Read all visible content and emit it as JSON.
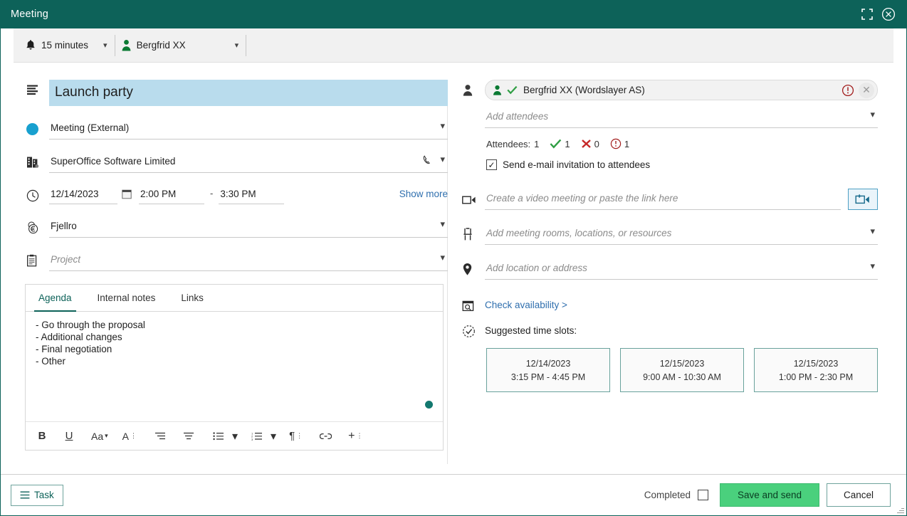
{
  "window": {
    "title": "Meeting",
    "maximize_icon": "fullscreen-icon",
    "close_icon": "close-circle-icon"
  },
  "toolbar": {
    "reminder": {
      "icon": "bell-icon",
      "value": "15 minutes"
    },
    "owner": {
      "icon": "person-icon",
      "value": "Bergfrid XX"
    }
  },
  "left": {
    "title_field": {
      "value": "Launch party",
      "icon": "description-icon"
    },
    "category": {
      "value": "Meeting (External)",
      "icon": "category-dot-icon",
      "color": "#18a0cf"
    },
    "company": {
      "value": "SuperOffice Software Limited",
      "icon": "building-icon",
      "phone_icon": "phone-icon"
    },
    "date": {
      "icon": "clock-icon",
      "date_value": "12/14/2023",
      "calendar_icon": "calendar-icon",
      "start_time": "2:00 PM",
      "separator": "-",
      "end_time": "3:30 PM",
      "show_more": "Show more"
    },
    "sale": {
      "value": "Fjellro",
      "icon": "sale-euro-icon"
    },
    "project": {
      "placeholder": "Project",
      "icon": "clipboard-icon"
    },
    "editor": {
      "tabs": [
        {
          "label": "Agenda",
          "active": true
        },
        {
          "label": "Internal notes",
          "active": false
        },
        {
          "label": "Links",
          "active": false
        }
      ],
      "content_lines": [
        "- Go through the proposal",
        "- Additional changes",
        "- Final negotiation",
        "- Other"
      ],
      "toolbar_buttons": [
        {
          "name": "bold-button",
          "label": "B"
        },
        {
          "name": "underline-button",
          "label": "U"
        },
        {
          "name": "font-size-button",
          "label": "Aa"
        },
        {
          "name": "text-color-button",
          "label": "A"
        },
        {
          "name": "align-right-button",
          "label": ""
        },
        {
          "name": "align-center-button",
          "label": ""
        },
        {
          "name": "bullet-list-button",
          "label": ""
        },
        {
          "name": "numbered-list-button",
          "label": ""
        },
        {
          "name": "paragraph-button",
          "label": "¶"
        },
        {
          "name": "insert-link-button",
          "label": ""
        },
        {
          "name": "insert-more-button",
          "label": "+"
        }
      ]
    }
  },
  "right": {
    "attendee_chip": {
      "icon": "person-icon",
      "status_icon": "check-icon",
      "name": "Bergfrid XX (Wordslayer AS)",
      "warning_icon": "warning-circle-icon",
      "remove_icon": "close-icon"
    },
    "add_attendees": {
      "placeholder": "Add attendees"
    },
    "attendee_stats": {
      "label": "Attendees:",
      "total": "1",
      "accepted": "1",
      "declined": "0",
      "pending": "1"
    },
    "send_invitation": {
      "label": "Send e-mail invitation to attendees",
      "checked": true
    },
    "video": {
      "icon": "video-camera-icon",
      "placeholder": "Create a video meeting or paste the link here",
      "button_icon": "add-video-icon"
    },
    "rooms": {
      "icon": "chair-icon",
      "placeholder": "Add meeting rooms, locations, or resources"
    },
    "location": {
      "icon": "location-pin-icon",
      "placeholder": "Add location or address"
    },
    "check_availability": {
      "icon": "calendar-search-icon",
      "label": "Check availability >"
    },
    "suggested": {
      "icon": "clock-check-icon",
      "label": "Suggested time slots:",
      "slots": [
        {
          "date": "12/14/2023",
          "time": "3:15 PM - 4:45 PM"
        },
        {
          "date": "12/15/2023",
          "time": "9:00 AM - 10:30 AM"
        },
        {
          "date": "12/15/2023",
          "time": "1:00 PM - 2:30 PM"
        }
      ]
    }
  },
  "footer": {
    "task_button": "Task",
    "completed_label": "Completed",
    "completed_checked": false,
    "save_button": "Save and send",
    "cancel_button": "Cancel"
  }
}
